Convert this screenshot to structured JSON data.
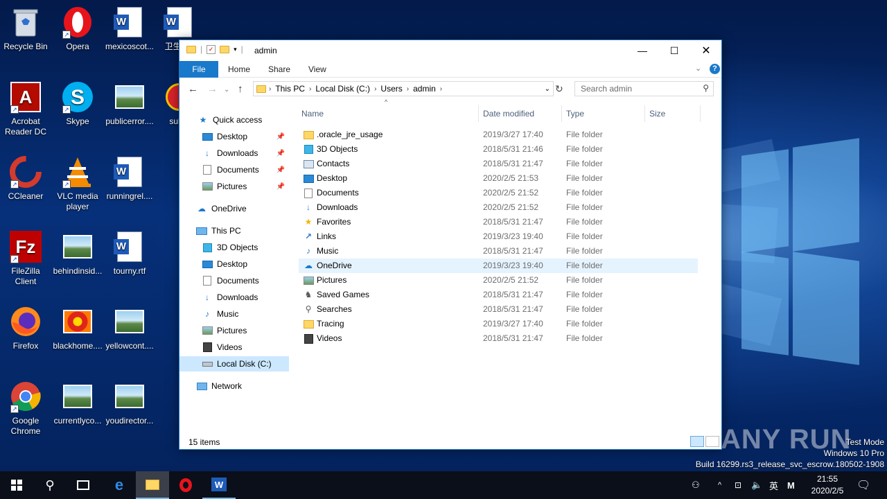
{
  "desktop": {
    "icons": [
      {
        "label": "Recycle Bin",
        "icon": "recycle-bin-icon"
      },
      {
        "label": "Opera",
        "icon": "opera-icon"
      },
      {
        "label": "mexicoscot...",
        "icon": "word-doc-icon"
      },
      {
        "label": "卫生部d",
        "icon": "word-doc-icon"
      },
      {
        "label": "Acrobat Reader DC",
        "icon": "acrobat-icon"
      },
      {
        "label": "Skype",
        "icon": "skype-icon"
      },
      {
        "label": "publicerror....",
        "icon": "image-file-icon"
      },
      {
        "label": "subm",
        "icon": "emblem-icon"
      },
      {
        "label": "CCleaner",
        "icon": "ccleaner-icon"
      },
      {
        "label": "VLC media player",
        "icon": "vlc-icon"
      },
      {
        "label": "runningrel....",
        "icon": "word-doc-icon"
      },
      {
        "label": "FileZilla Client",
        "icon": "filezilla-icon"
      },
      {
        "label": "behindinsid...",
        "icon": "image-file-icon"
      },
      {
        "label": "tourny.rtf",
        "icon": "word-doc-icon"
      },
      {
        "label": "Firefox",
        "icon": "firefox-icon"
      },
      {
        "label": "blackhome....",
        "icon": "flower-image-icon"
      },
      {
        "label": "yellowcont....",
        "icon": "image-file-icon"
      },
      {
        "label": "Google Chrome",
        "icon": "chrome-icon"
      },
      {
        "label": "currentlyco...",
        "icon": "image-file-icon"
      },
      {
        "label": "youdirector...",
        "icon": "image-file-icon"
      }
    ]
  },
  "window": {
    "title": "admin",
    "ribbon_tabs": [
      "File",
      "Home",
      "Share",
      "View"
    ],
    "address": [
      "This PC",
      "Local Disk (C:)",
      "Users",
      "admin"
    ],
    "search_placeholder": "Search admin",
    "nav": {
      "quick_access": "Quick access",
      "quick_items": [
        "Desktop",
        "Downloads",
        "Documents",
        "Pictures"
      ],
      "onedrive": "OneDrive",
      "this_pc": "This PC",
      "pc_items": [
        "3D Objects",
        "Desktop",
        "Documents",
        "Downloads",
        "Music",
        "Pictures",
        "Videos",
        "Local Disk (C:)"
      ],
      "network": "Network"
    },
    "columns": [
      "Name",
      "Date modified",
      "Type",
      "Size"
    ],
    "files": [
      {
        "name": ".oracle_jre_usage",
        "date": "2019/3/27 17:40",
        "type": "File folder",
        "icon": "folder-icon"
      },
      {
        "name": "3D Objects",
        "date": "2018/5/31 21:46",
        "type": "File folder",
        "icon": "3d-objects-icon"
      },
      {
        "name": "Contacts",
        "date": "2018/5/31 21:47",
        "type": "File folder",
        "icon": "contacts-icon"
      },
      {
        "name": "Desktop",
        "date": "2020/2/5 21:53",
        "type": "File folder",
        "icon": "desktop-icon"
      },
      {
        "name": "Documents",
        "date": "2020/2/5 21:52",
        "type": "File folder",
        "icon": "documents-icon"
      },
      {
        "name": "Downloads",
        "date": "2020/2/5 21:52",
        "type": "File folder",
        "icon": "downloads-icon"
      },
      {
        "name": "Favorites",
        "date": "2018/5/31 21:47",
        "type": "File folder",
        "icon": "favorites-icon"
      },
      {
        "name": "Links",
        "date": "2019/3/23 19:40",
        "type": "File folder",
        "icon": "links-icon"
      },
      {
        "name": "Music",
        "date": "2018/5/31 21:47",
        "type": "File folder",
        "icon": "music-icon"
      },
      {
        "name": "OneDrive",
        "date": "2019/3/23 19:40",
        "type": "File folder",
        "icon": "onedrive-icon"
      },
      {
        "name": "Pictures",
        "date": "2020/2/5 21:52",
        "type": "File folder",
        "icon": "pictures-icon"
      },
      {
        "name": "Saved Games",
        "date": "2018/5/31 21:47",
        "type": "File folder",
        "icon": "saved-games-icon"
      },
      {
        "name": "Searches",
        "date": "2018/5/31 21:47",
        "type": "File folder",
        "icon": "searches-icon"
      },
      {
        "name": "Tracing",
        "date": "2019/3/27 17:40",
        "type": "File folder",
        "icon": "folder-icon"
      },
      {
        "name": "Videos",
        "date": "2018/5/31 21:47",
        "type": "File folder",
        "icon": "videos-icon"
      }
    ],
    "status": "15 items"
  },
  "watermark": "ANY RUN",
  "testmode": {
    "line1": "Test Mode",
    "line2": "Windows 10 Pro",
    "line3": "Build 16299.rs3_release_svc_escrow.180502-1908"
  },
  "taskbar": {
    "ime": "英",
    "clock_time": "21:55",
    "clock_date": "2020/2/5"
  },
  "colors": {
    "accent": "#1979ca",
    "selection": "#cce8ff",
    "hover": "#e5f3ff",
    "taskbar": "#0b0f1a"
  }
}
